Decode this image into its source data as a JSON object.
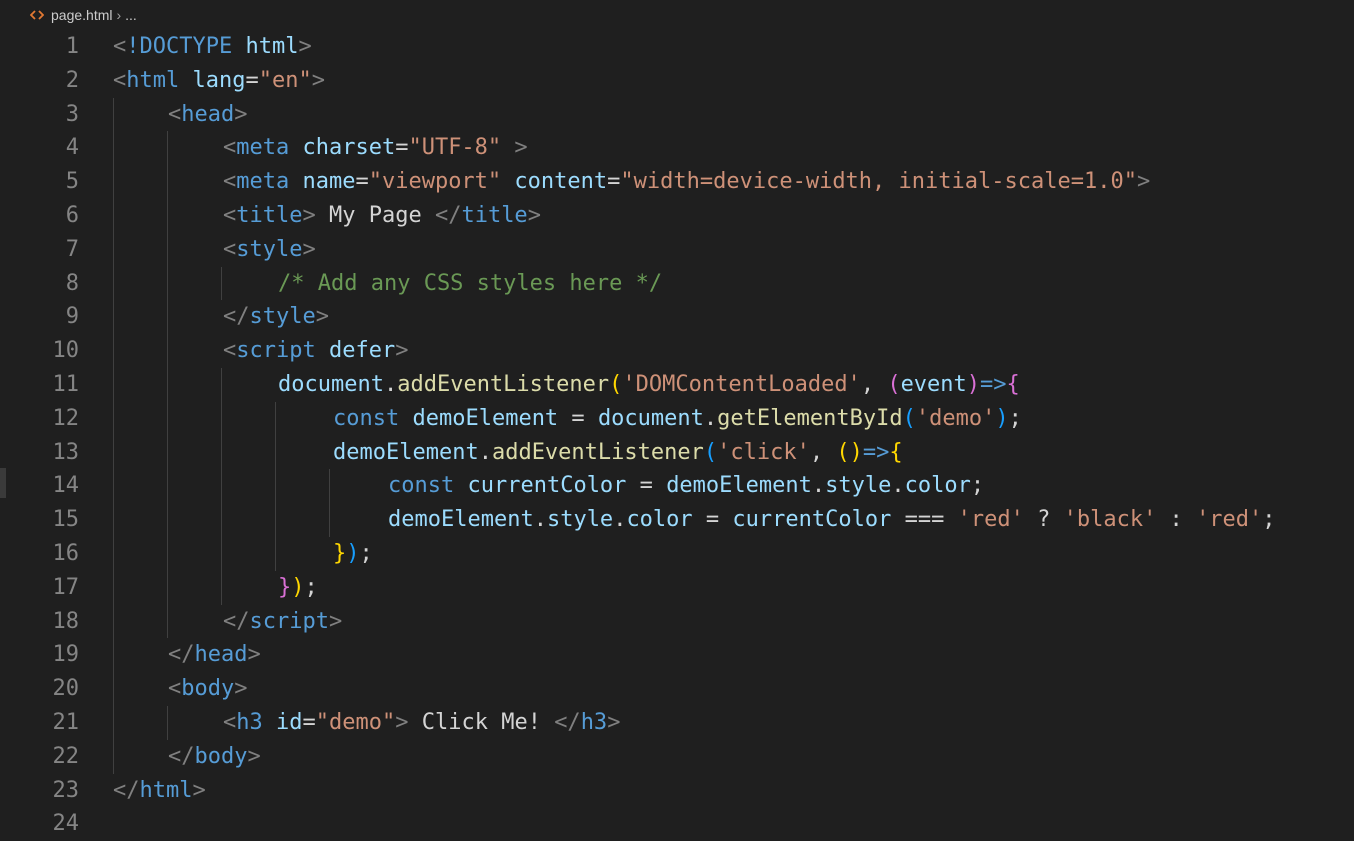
{
  "breadcrumb": {
    "file": "page.html",
    "separator": "›",
    "more": "...",
    "file_icon": "html-file-icon"
  },
  "colors": {
    "background": "#1f1f1f",
    "line_number": "#858585",
    "tag": "#569cd6",
    "attribute": "#9cdcfe",
    "string": "#ce9178",
    "comment": "#6a9955",
    "function": "#dcdcaa",
    "bracket_gold": "#ffd700",
    "bracket_purple": "#da70d6",
    "bracket_blue": "#179fff"
  },
  "code": {
    "lines": [
      {
        "num": "1",
        "indent": 0,
        "tokens": [
          [
            "bracket",
            "<"
          ],
          [
            "doctype",
            "!DOCTYPE"
          ],
          [
            "text",
            " "
          ],
          [
            "attr",
            "html"
          ],
          [
            "bracket",
            ">"
          ]
        ]
      },
      {
        "num": "2",
        "indent": 0,
        "tokens": [
          [
            "bracket",
            "<"
          ],
          [
            "tag",
            "html"
          ],
          [
            "text",
            " "
          ],
          [
            "attr",
            "lang"
          ],
          [
            "op",
            "="
          ],
          [
            "str",
            "\"en\""
          ],
          [
            "bracket",
            ">"
          ]
        ]
      },
      {
        "num": "3",
        "indent": 1,
        "tokens": [
          [
            "bracket",
            "<"
          ],
          [
            "tag",
            "head"
          ],
          [
            "bracket",
            ">"
          ]
        ]
      },
      {
        "num": "4",
        "indent": 2,
        "tokens": [
          [
            "bracket",
            "<"
          ],
          [
            "tag",
            "meta"
          ],
          [
            "text",
            " "
          ],
          [
            "attr",
            "charset"
          ],
          [
            "op",
            "="
          ],
          [
            "str",
            "\"UTF-8\""
          ],
          [
            "text",
            " "
          ],
          [
            "bracket",
            ">"
          ]
        ]
      },
      {
        "num": "5",
        "indent": 2,
        "tokens": [
          [
            "bracket",
            "<"
          ],
          [
            "tag",
            "meta"
          ],
          [
            "text",
            " "
          ],
          [
            "attr",
            "name"
          ],
          [
            "op",
            "="
          ],
          [
            "str",
            "\"viewport\""
          ],
          [
            "text",
            " "
          ],
          [
            "attr",
            "content"
          ],
          [
            "op",
            "="
          ],
          [
            "str",
            "\"width=device-width, initial-scale=1.0\""
          ],
          [
            "bracket",
            ">"
          ]
        ]
      },
      {
        "num": "6",
        "indent": 2,
        "tokens": [
          [
            "bracket",
            "<"
          ],
          [
            "tag",
            "title"
          ],
          [
            "bracket",
            ">"
          ],
          [
            "text",
            " My Page "
          ],
          [
            "bracket",
            "</"
          ],
          [
            "tag",
            "title"
          ],
          [
            "bracket",
            ">"
          ]
        ]
      },
      {
        "num": "7",
        "indent": 2,
        "tokens": [
          [
            "bracket",
            "<"
          ],
          [
            "tag",
            "style"
          ],
          [
            "bracket",
            ">"
          ]
        ]
      },
      {
        "num": "8",
        "indent": 3,
        "tokens": [
          [
            "comment",
            "/* Add any CSS styles here */"
          ]
        ]
      },
      {
        "num": "9",
        "indent": 2,
        "tokens": [
          [
            "bracket",
            "</"
          ],
          [
            "tag",
            "style"
          ],
          [
            "bracket",
            ">"
          ]
        ]
      },
      {
        "num": "10",
        "indent": 2,
        "tokens": [
          [
            "bracket",
            "<"
          ],
          [
            "tag",
            "script"
          ],
          [
            "text",
            " "
          ],
          [
            "attr",
            "defer"
          ],
          [
            "bracket",
            ">"
          ]
        ]
      },
      {
        "num": "11",
        "indent": 3,
        "tokens": [
          [
            "var",
            "document"
          ],
          [
            "op",
            "."
          ],
          [
            "fn",
            "addEventListener"
          ],
          [
            "p1",
            "("
          ],
          [
            "str",
            "'DOMContentLoaded'"
          ],
          [
            "op",
            ", "
          ],
          [
            "p2",
            "("
          ],
          [
            "var",
            "event"
          ],
          [
            "p2",
            ")"
          ],
          [
            "kw",
            "=>"
          ],
          [
            "p2",
            "{"
          ]
        ]
      },
      {
        "num": "12",
        "indent": 4,
        "tokens": [
          [
            "kw",
            "const"
          ],
          [
            "text",
            " "
          ],
          [
            "var",
            "demoElement"
          ],
          [
            "op",
            " = "
          ],
          [
            "var",
            "document"
          ],
          [
            "op",
            "."
          ],
          [
            "fn",
            "getElementById"
          ],
          [
            "p3",
            "("
          ],
          [
            "str",
            "'demo'"
          ],
          [
            "p3",
            ")"
          ],
          [
            "op",
            ";"
          ]
        ]
      },
      {
        "num": "13",
        "indent": 4,
        "tokens": [
          [
            "var",
            "demoElement"
          ],
          [
            "op",
            "."
          ],
          [
            "fn",
            "addEventListener"
          ],
          [
            "p3",
            "("
          ],
          [
            "str",
            "'click'"
          ],
          [
            "op",
            ", "
          ],
          [
            "p1",
            "()"
          ],
          [
            "kw",
            "=>"
          ],
          [
            "p1",
            "{"
          ]
        ]
      },
      {
        "num": "14",
        "indent": 5,
        "tokens": [
          [
            "kw",
            "const"
          ],
          [
            "text",
            " "
          ],
          [
            "var",
            "currentColor"
          ],
          [
            "op",
            " = "
          ],
          [
            "var",
            "demoElement"
          ],
          [
            "op",
            "."
          ],
          [
            "var",
            "style"
          ],
          [
            "op",
            "."
          ],
          [
            "var",
            "color"
          ],
          [
            "op",
            ";"
          ]
        ]
      },
      {
        "num": "15",
        "indent": 5,
        "tokens": [
          [
            "var",
            "demoElement"
          ],
          [
            "op",
            "."
          ],
          [
            "var",
            "style"
          ],
          [
            "op",
            "."
          ],
          [
            "var",
            "color"
          ],
          [
            "op",
            " = "
          ],
          [
            "var",
            "currentColor"
          ],
          [
            "op",
            " === "
          ],
          [
            "str",
            "'red'"
          ],
          [
            "op",
            " ? "
          ],
          [
            "str",
            "'black'"
          ],
          [
            "op",
            " : "
          ],
          [
            "str",
            "'red'"
          ],
          [
            "op",
            ";"
          ]
        ]
      },
      {
        "num": "16",
        "indent": 4,
        "tokens": [
          [
            "p1",
            "}"
          ],
          [
            "p3",
            ")"
          ],
          [
            "op",
            ";"
          ]
        ]
      },
      {
        "num": "17",
        "indent": 3,
        "tokens": [
          [
            "p2",
            "}"
          ],
          [
            "p1",
            ")"
          ],
          [
            "op",
            ";"
          ]
        ]
      },
      {
        "num": "18",
        "indent": 2,
        "tokens": [
          [
            "bracket",
            "</"
          ],
          [
            "tag",
            "script"
          ],
          [
            "bracket",
            ">"
          ]
        ]
      },
      {
        "num": "19",
        "indent": 1,
        "tokens": [
          [
            "bracket",
            "</"
          ],
          [
            "tag",
            "head"
          ],
          [
            "bracket",
            ">"
          ]
        ]
      },
      {
        "num": "20",
        "indent": 1,
        "tokens": [
          [
            "bracket",
            "<"
          ],
          [
            "tag",
            "body"
          ],
          [
            "bracket",
            ">"
          ]
        ]
      },
      {
        "num": "21",
        "indent": 2,
        "tokens": [
          [
            "bracket",
            "<"
          ],
          [
            "tag",
            "h3"
          ],
          [
            "text",
            " "
          ],
          [
            "attr",
            "id"
          ],
          [
            "op",
            "="
          ],
          [
            "str",
            "\"demo\""
          ],
          [
            "bracket",
            ">"
          ],
          [
            "text",
            " Click Me! "
          ],
          [
            "bracket",
            "</"
          ],
          [
            "tag",
            "h3"
          ],
          [
            "bracket",
            ">"
          ]
        ]
      },
      {
        "num": "22",
        "indent": 1,
        "tokens": [
          [
            "bracket",
            "</"
          ],
          [
            "tag",
            "body"
          ],
          [
            "bracket",
            ">"
          ]
        ]
      },
      {
        "num": "23",
        "indent": 0,
        "tokens": [
          [
            "bracket",
            "</"
          ],
          [
            "tag",
            "html"
          ],
          [
            "bracket",
            ">"
          ]
        ]
      },
      {
        "num": "24",
        "indent": 0,
        "tokens": []
      }
    ]
  }
}
